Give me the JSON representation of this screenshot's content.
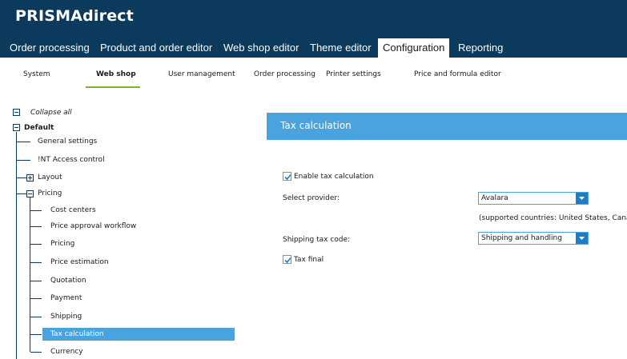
{
  "app": {
    "title": "PRISMAdirect"
  },
  "main_nav": {
    "tabs": [
      {
        "label": "Order processing"
      },
      {
        "label": "Product and order editor"
      },
      {
        "label": "Web shop editor"
      },
      {
        "label": "Theme editor"
      },
      {
        "label": "Configuration",
        "active": true
      },
      {
        "label": "Reporting"
      }
    ]
  },
  "sub_nav": {
    "items": [
      {
        "label": "System"
      },
      {
        "label": "Web shop",
        "active": true
      },
      {
        "label": "User management"
      },
      {
        "label": "Order processing"
      },
      {
        "label": "Printer settings"
      },
      {
        "label": "Price and formula editor"
      }
    ]
  },
  "tree": {
    "collapse_all": "Collapse all",
    "root": "Default",
    "items": {
      "general_settings": "General settings",
      "int_access_control": "!NT Access control",
      "layout": "Layout",
      "pricing_group": "Pricing",
      "cost_centers": "Cost centers",
      "price_approval_workflow": "Price approval workflow",
      "pricing": "Pricing",
      "price_estimation": "Price estimation",
      "quotation": "Quotation",
      "payment": "Payment",
      "shipping": "Shipping",
      "tax_calculation": "Tax calculation",
      "currency": "Currency"
    },
    "selected": "Tax calculation"
  },
  "panel": {
    "title": "Tax calculation",
    "enable_tax": {
      "label": "Enable tax calculation",
      "checked": true
    },
    "provider": {
      "label": "Select provider:",
      "value": "Avalara",
      "note": "(supported countries: United States, Canada)"
    },
    "shipping_tax_code": {
      "label": "Shipping tax code:",
      "value": "Shipping and handling"
    },
    "tax_final": {
      "label": "Tax final",
      "checked": true
    }
  },
  "colors": {
    "header_bg": "#0b3a5c",
    "accent": "#4aa3df",
    "underline": "#7ab33a",
    "dropdown_button": "#1f7bc4"
  }
}
